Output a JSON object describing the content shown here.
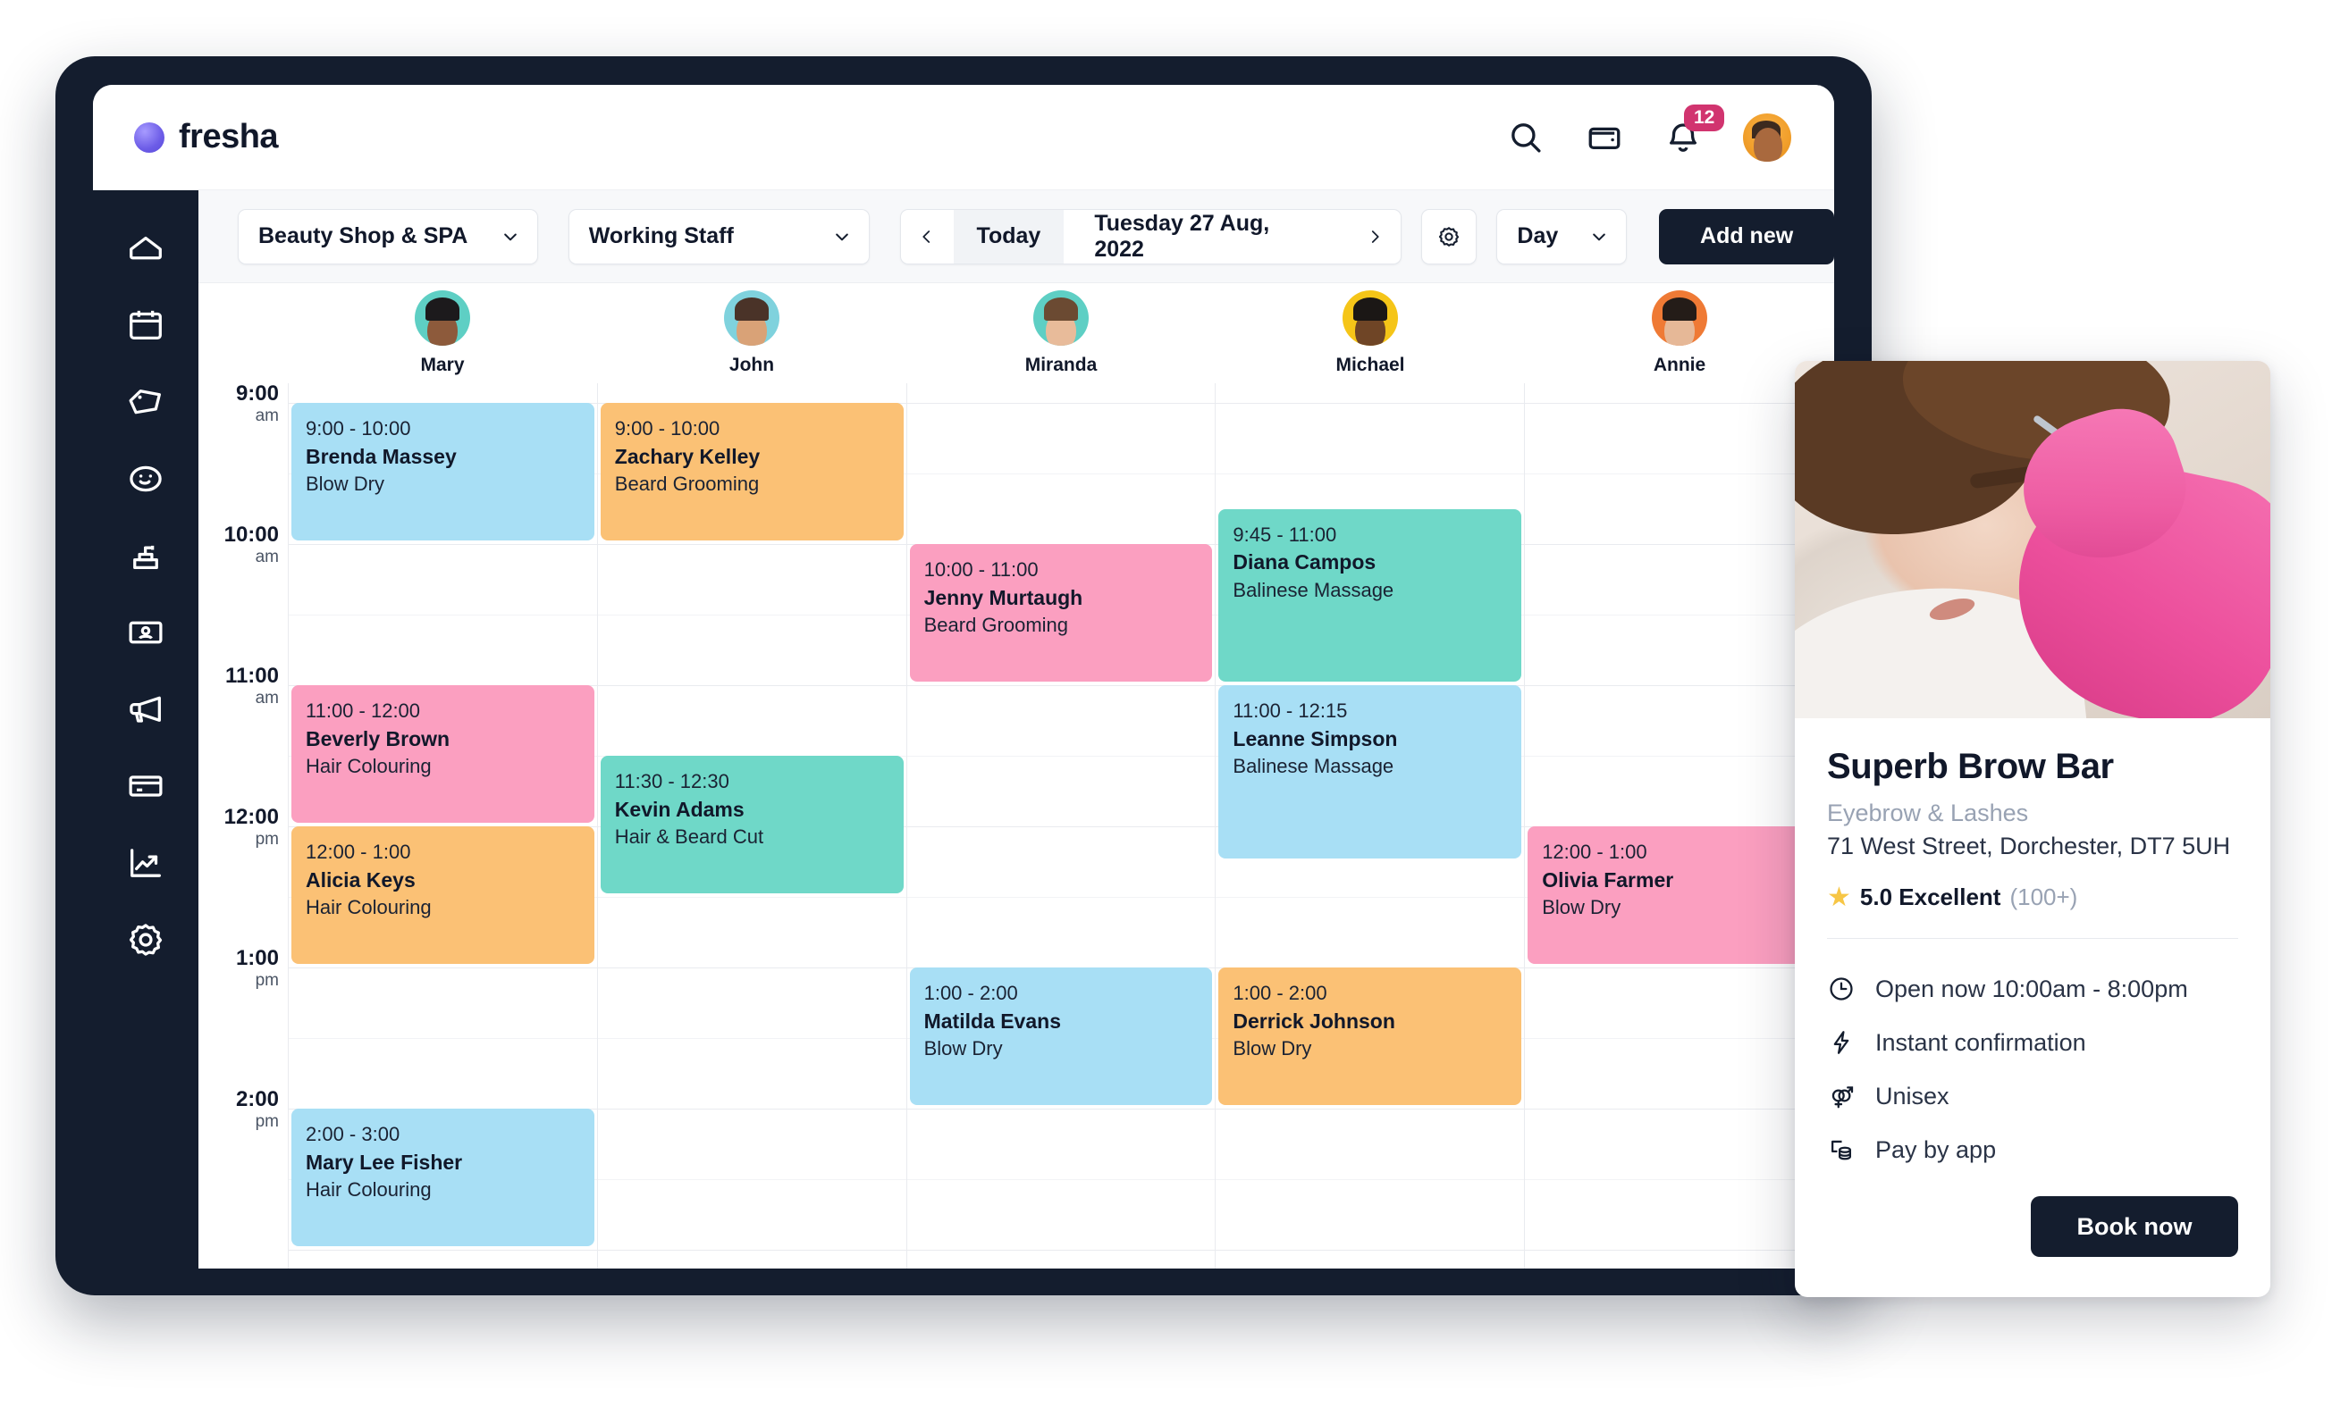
{
  "app": {
    "brand_name": "fresha",
    "notification_count": "12",
    "icons": {
      "search": "search-icon",
      "wallet": "wallet-icon",
      "bell": "bell-icon",
      "avatar": "user-avatar"
    }
  },
  "sidebar": {
    "items": [
      {
        "name": "home",
        "label": "Home"
      },
      {
        "name": "calendar",
        "label": "Calendar"
      },
      {
        "name": "tag",
        "label": "Sales"
      },
      {
        "name": "smiley",
        "label": "Clients"
      },
      {
        "name": "product",
        "label": "Products"
      },
      {
        "name": "id-card",
        "label": "Team"
      },
      {
        "name": "megaphone",
        "label": "Marketing"
      },
      {
        "name": "payment-card",
        "label": "Payments"
      },
      {
        "name": "analytics",
        "label": "Reports"
      },
      {
        "name": "gear",
        "label": "Settings"
      }
    ]
  },
  "toolbar": {
    "location_select": "Beauty Shop & SPA",
    "staff_select": "Working Staff",
    "today_label": "Today",
    "current_date": "Tuesday 27 Aug, 2022",
    "view_select": "Day",
    "add_new_label": "Add new",
    "prev_label": "‹",
    "next_label": "›"
  },
  "calendar": {
    "time_labels": [
      {
        "hour": "9:00",
        "meridiem": "am"
      },
      {
        "hour": "10:00",
        "meridiem": "am"
      },
      {
        "hour": "11:00",
        "meridiem": "am"
      },
      {
        "hour": "12:00",
        "meridiem": "pm"
      },
      {
        "hour": "1:00",
        "meridiem": "pm"
      },
      {
        "hour": "2:00",
        "meridiem": "pm"
      }
    ],
    "staff": [
      {
        "name": "Mary",
        "avatar_bg": "#5ecfc4",
        "hair": "#1c1a1c",
        "skin": "#8d5a3b"
      },
      {
        "name": "John",
        "avatar_bg": "#7fd2dd",
        "hair": "#4a3328",
        "skin": "#d9a277"
      },
      {
        "name": "Miranda",
        "avatar_bg": "#5ecfc4",
        "hair": "#6b4a32",
        "skin": "#e8bb9a"
      },
      {
        "name": "Michael",
        "avatar_bg": "#f5c518",
        "hair": "#1b1715",
        "skin": "#6f4526"
      },
      {
        "name": "Annie",
        "avatar_bg": "#ef7a35",
        "hair": "#241c18",
        "skin": "#e6b897"
      }
    ],
    "colors": {
      "blue": "#a8dff5",
      "orange": "#fbc175",
      "pink": "#fb9fc0",
      "teal": "#6fd8c8"
    },
    "appointments": [
      {
        "staff": "Mary",
        "time": "9:00 - 10:00",
        "client": "Brenda Massey",
        "service": "Blow Dry",
        "color": "blue"
      },
      {
        "staff": "Mary",
        "time": "11:00 - 12:00",
        "client": "Beverly Brown",
        "service": "Hair Colouring",
        "color": "pink"
      },
      {
        "staff": "Mary",
        "time": "12:00 - 1:00",
        "client": "Alicia Keys",
        "service": "Hair Colouring",
        "color": "orange"
      },
      {
        "staff": "Mary",
        "time": "2:00 - 3:00",
        "client": "Mary Lee Fisher",
        "service": "Hair Colouring",
        "color": "blue"
      },
      {
        "staff": "John",
        "time": "9:00 - 10:00",
        "client": "Zachary Kelley",
        "service": "Beard Grooming",
        "color": "orange"
      },
      {
        "staff": "John",
        "time": "11:30 - 12:30",
        "client": "Kevin Adams",
        "service": "Hair & Beard Cut",
        "color": "teal"
      },
      {
        "staff": "Miranda",
        "time": "10:00 - 11:00",
        "client": "Jenny Murtaugh",
        "service": "Beard Grooming",
        "color": "pink"
      },
      {
        "staff": "Miranda",
        "time": "1:00 - 2:00",
        "client": "Matilda Evans",
        "service": "Blow Dry",
        "color": "blue"
      },
      {
        "staff": "Michael",
        "time": "9:45 - 11:00",
        "client": "Diana Campos",
        "service": "Balinese Massage",
        "color": "teal"
      },
      {
        "staff": "Michael",
        "time": "11:00 - 12:15",
        "client": "Leanne Simpson",
        "service": "Balinese Massage",
        "color": "blue"
      },
      {
        "staff": "Michael",
        "time": "1:00 - 2:00",
        "client": "Derrick Johnson",
        "service": "Blow Dry",
        "color": "orange"
      },
      {
        "staff": "Annie",
        "time": "12:00 - 1:00",
        "client": "Olivia Farmer",
        "service": "Blow Dry",
        "color": "pink"
      }
    ]
  },
  "business_card": {
    "title": "Superb Brow Bar",
    "category": "Eyebrow & Lashes",
    "address": "71 West Street, Dorchester, DT7 5UH",
    "rating_value": "5.0 Excellent",
    "rating_count": "(100+)",
    "features": [
      {
        "icon": "clock-icon",
        "text": "Open now 10:00am - 8:00pm"
      },
      {
        "icon": "lightning-icon",
        "text": "Instant confirmation"
      },
      {
        "icon": "unisex-icon",
        "text": "Unisex"
      },
      {
        "icon": "pay-app-icon",
        "text": "Pay by app"
      }
    ],
    "book_label": "Book now"
  }
}
